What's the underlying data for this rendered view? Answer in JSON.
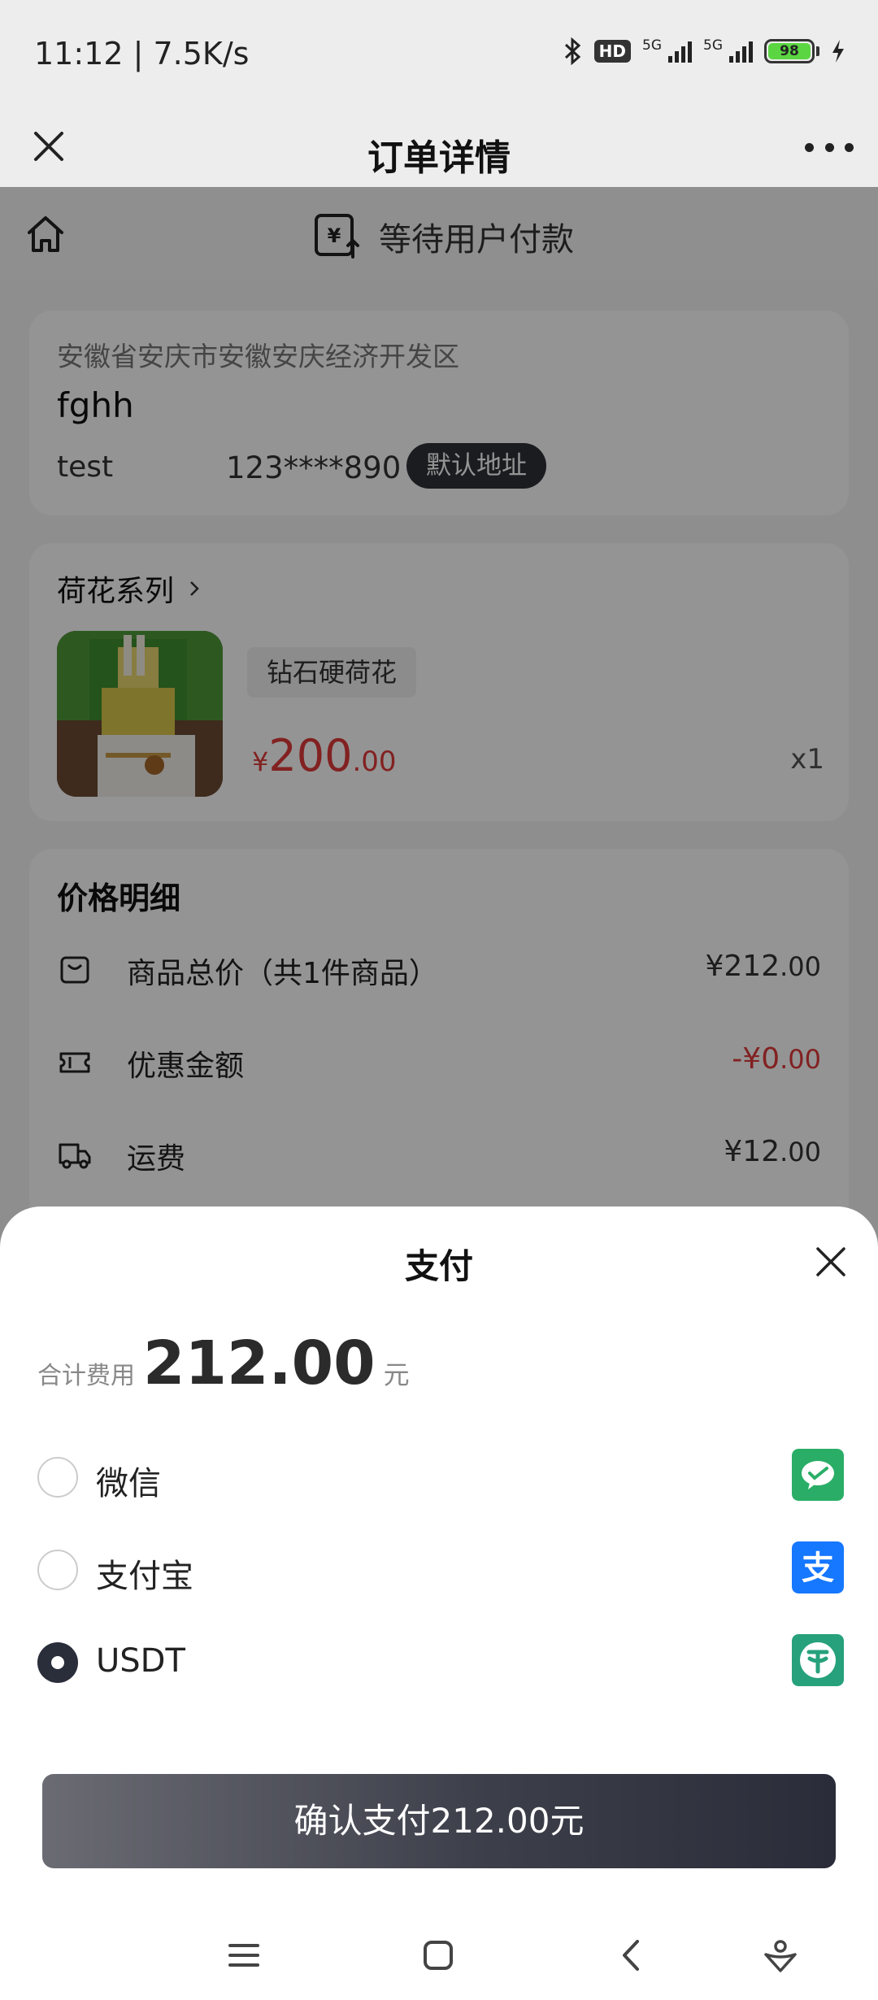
{
  "status_bar": {
    "time": "11:12 | 7.5K/s",
    "hd_label": "HD",
    "net1": "5G",
    "net2": "5G",
    "battery": "98"
  },
  "header": {
    "title": "订单详情"
  },
  "order_status": {
    "text": "等待用户付款"
  },
  "address": {
    "region": "安徽省安庆市安徽安庆经济开发区",
    "name": "fghh",
    "person": "test",
    "phone": "123****890",
    "badge": "默认地址"
  },
  "product": {
    "series": "荷花系列",
    "tag": "钻石硬荷花",
    "currency": "¥",
    "price_int": "200",
    "price_dec": ".00",
    "qty": "x1"
  },
  "price_detail": {
    "heading": "价格明细",
    "rows": [
      {
        "label": "商品总价（共1件商品）",
        "amount_prefix": "¥",
        "amount_int": "212",
        "amount_dec": ".00"
      },
      {
        "label": "优惠金额",
        "amount_prefix": "-¥",
        "amount_int": "0",
        "amount_dec": ".00"
      },
      {
        "label": "运费",
        "amount_prefix": "¥",
        "amount_int": "12",
        "amount_dec": ".00"
      }
    ]
  },
  "payment_sheet": {
    "title": "支付",
    "total_label": "合计费用",
    "total_value": "212.00",
    "total_unit": "元",
    "methods": [
      {
        "name": "微信",
        "selected": false,
        "logo": "wechat-pay-icon",
        "color": "#2aae67"
      },
      {
        "name": "支付宝",
        "selected": false,
        "logo": "alipay-icon",
        "color": "#1677ff"
      },
      {
        "name": "USDT",
        "selected": true,
        "logo": "tether-icon",
        "color": "#26a17b"
      }
    ],
    "confirm_label": "确认支付212.00元"
  },
  "colors": {
    "accent_red": "#e03a3a",
    "dark_button": "#2a2c39"
  }
}
